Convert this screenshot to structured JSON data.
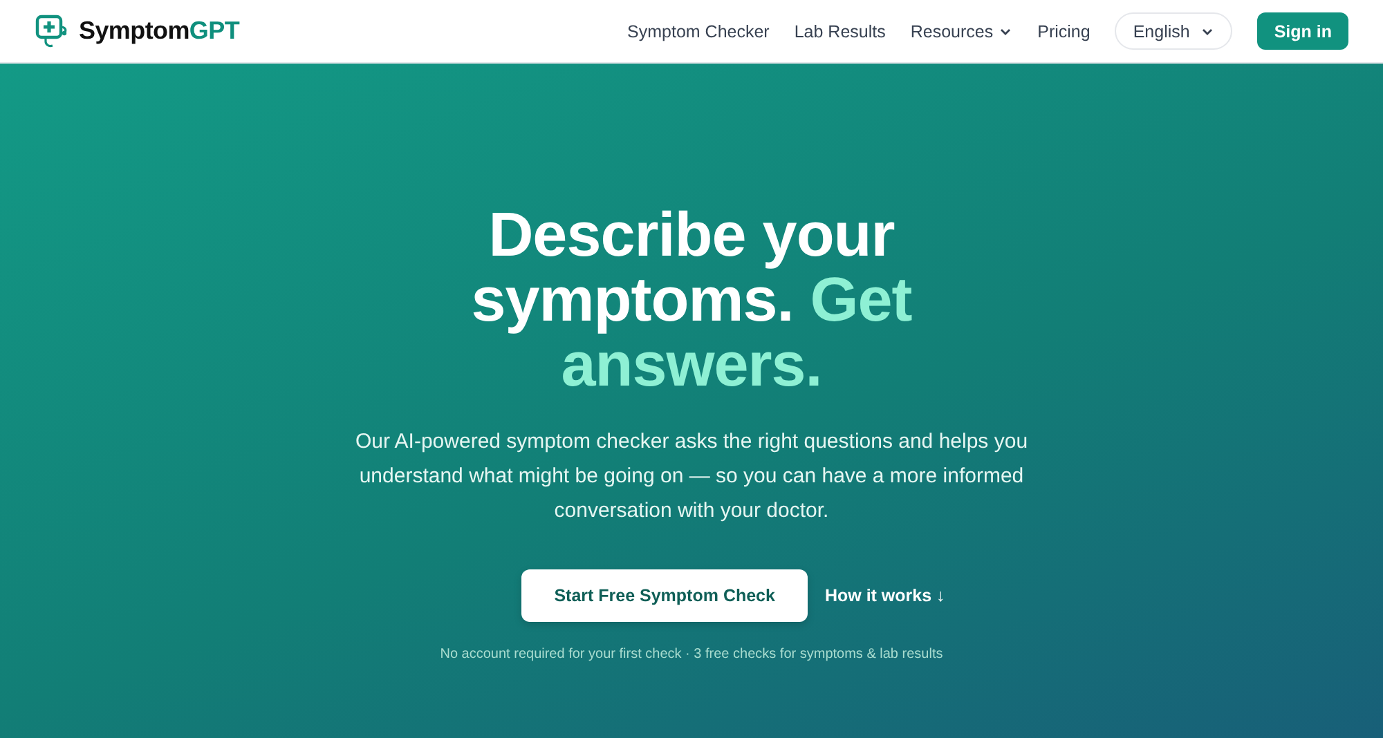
{
  "brand": {
    "name": "Symptom",
    "accent": "GPT"
  },
  "nav": [
    {
      "label": "Symptom Checker",
      "kind": "link"
    },
    {
      "label": "Lab Results",
      "kind": "link"
    },
    {
      "label": "Resources",
      "kind": "dropdown"
    },
    {
      "label": "Pricing",
      "kind": "link"
    }
  ],
  "language": {
    "value": "English"
  },
  "sign_in": "Sign in",
  "hero": {
    "headline": "Describe your symptoms.",
    "headline_highlight": "Get answers.",
    "description": "Our AI-powered symptom checker asks the right questions and helps you understand what might be going on — so you can have a more informed conversation with your doctor.",
    "primary_button": "Start Free Symptom Check",
    "secondary_link": "How it works ↓",
    "note": "No account required for your first check · 3 free checks for symptoms & lab results"
  }
}
